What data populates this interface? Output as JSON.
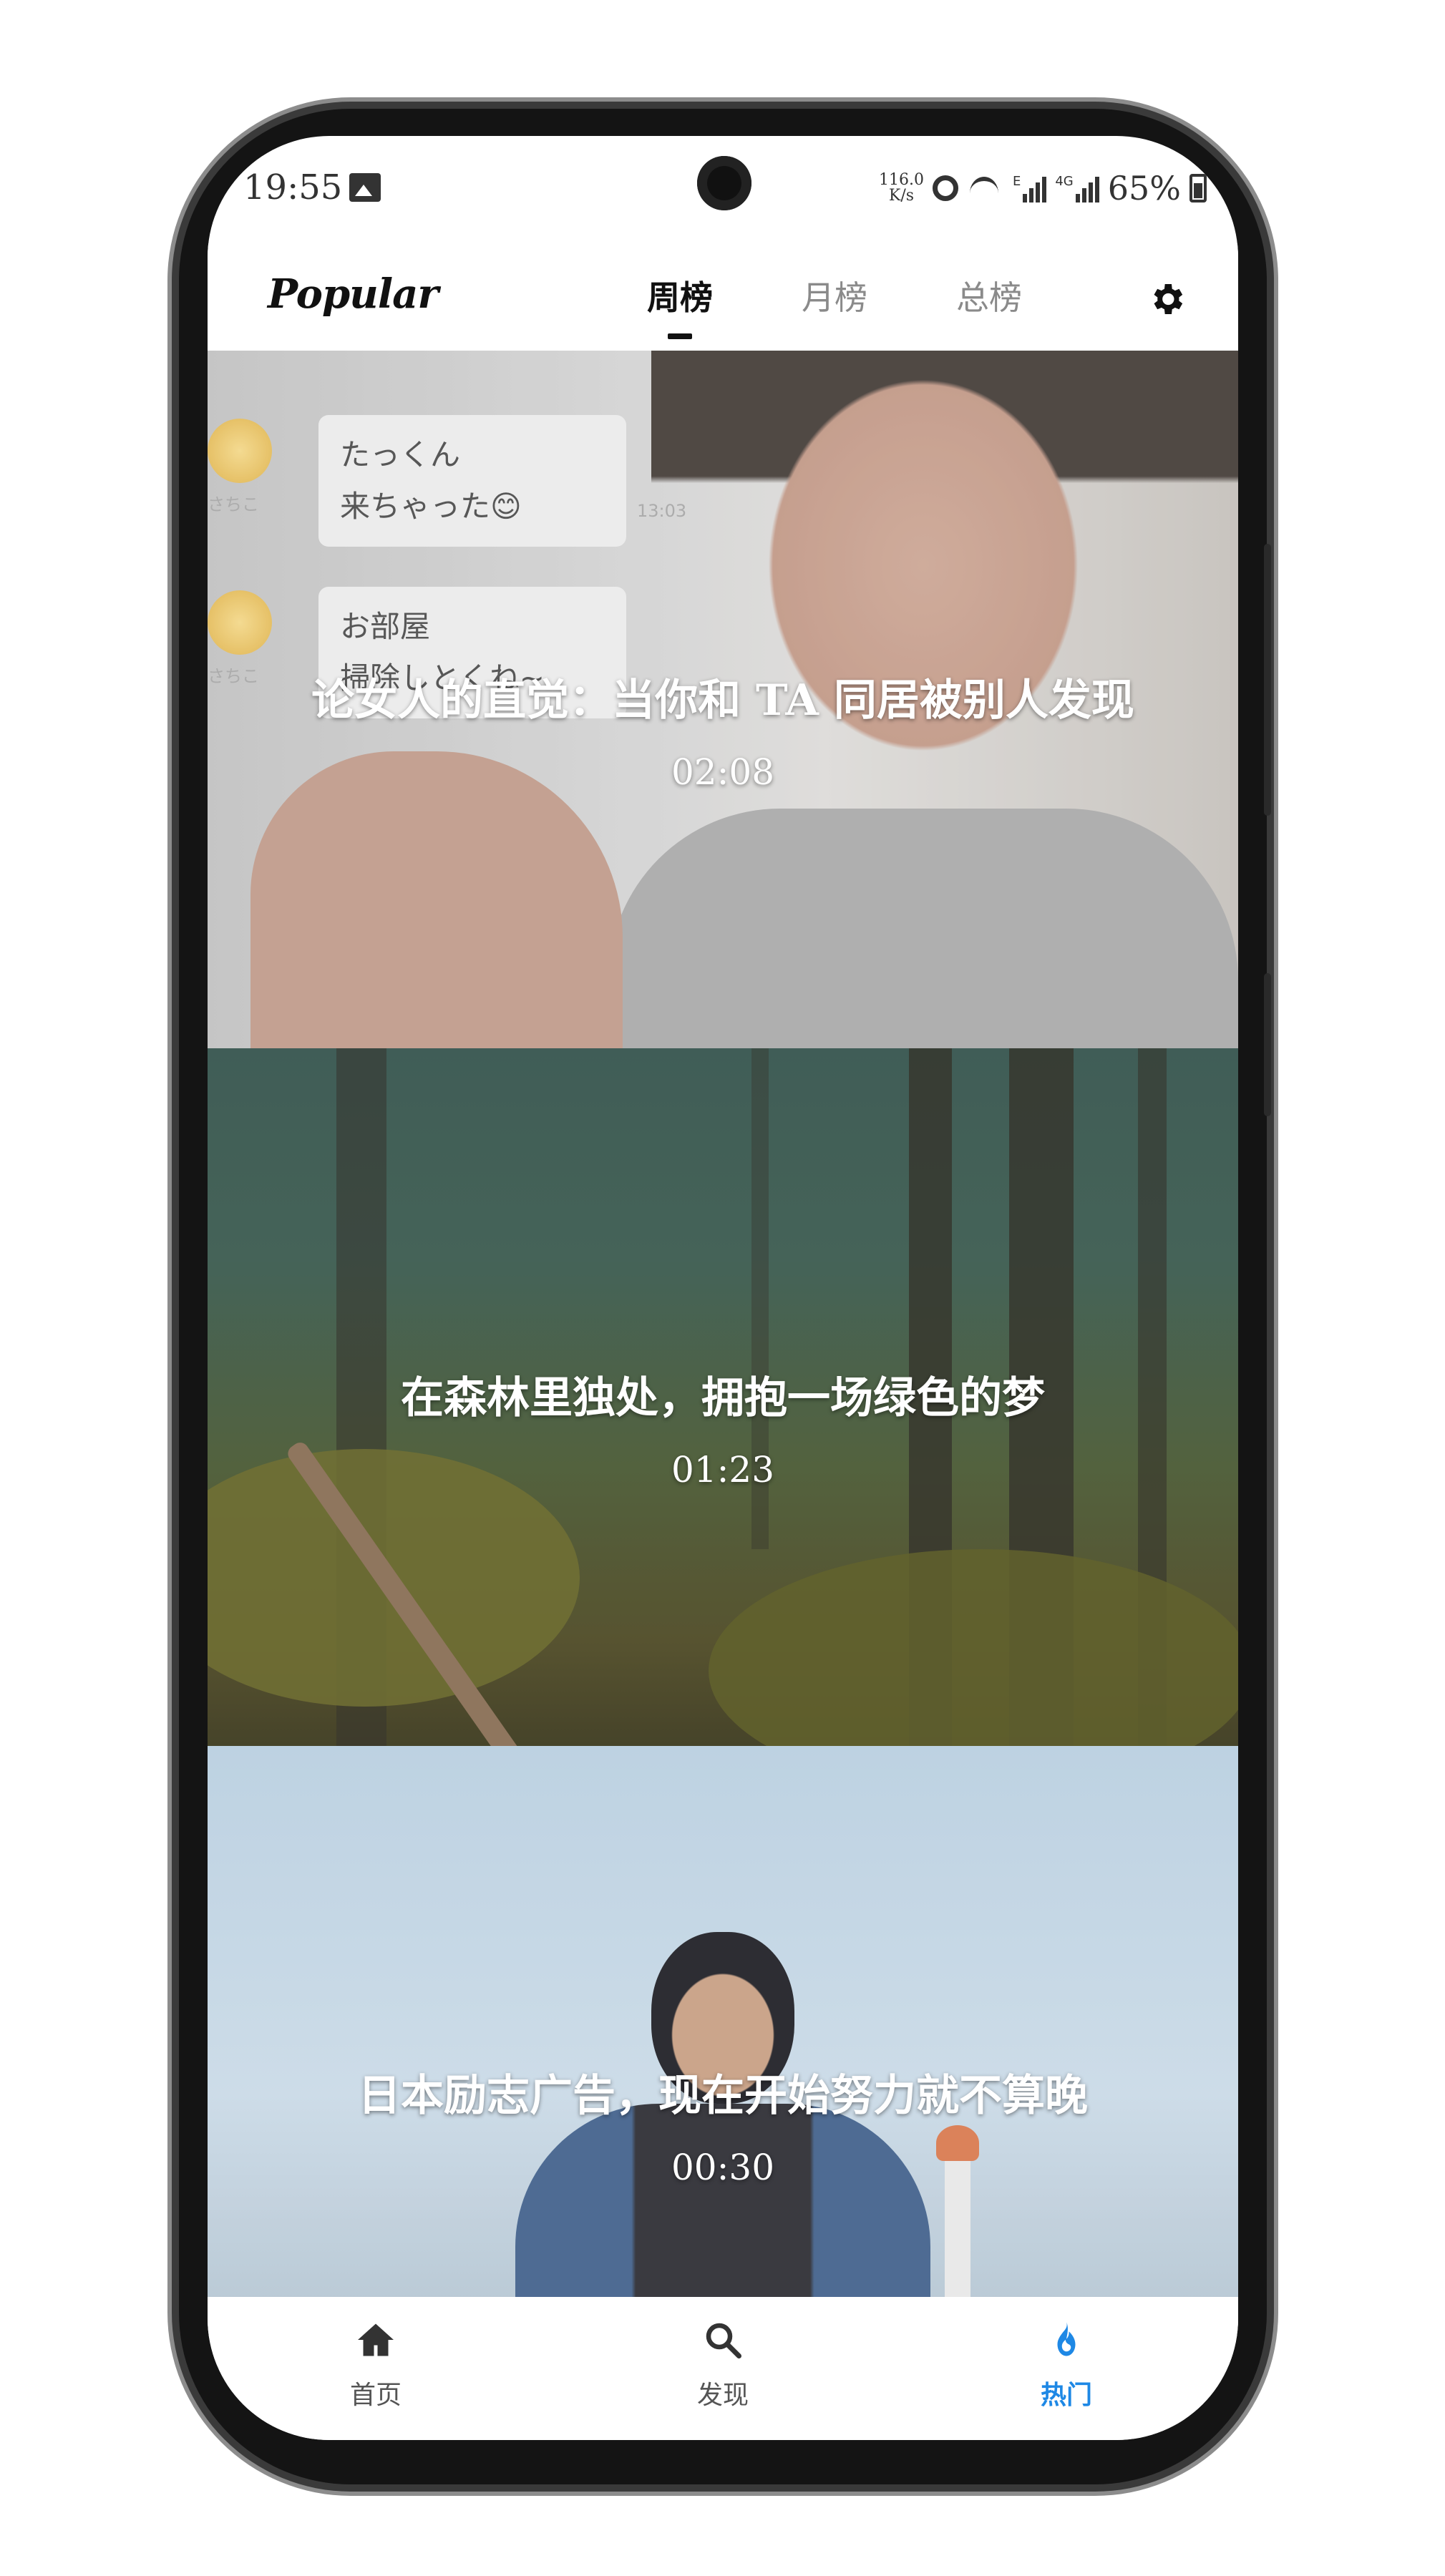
{
  "status_bar": {
    "time": "19:55",
    "net_speed_value": "116.0",
    "net_speed_unit": "K/s",
    "signal_1_tag": "E",
    "signal_2_tag": "4G",
    "battery": "65%"
  },
  "header": {
    "app_title": "Popular",
    "tabs": [
      {
        "label": "周榜",
        "active": true
      },
      {
        "label": "月榜",
        "active": false
      },
      {
        "label": "总榜",
        "active": false
      }
    ]
  },
  "videos": [
    {
      "title": "论女人的直觉：当你和 TA 同居被别人发现",
      "duration": "02:08",
      "chat": {
        "name": "さちこ",
        "bubble1_line1": "たっくん",
        "bubble1_line2": "来ちゃった😊",
        "time": "13:03",
        "bubble2_line1": "お部屋",
        "bubble2_line2": "掃除しとくね~"
      }
    },
    {
      "title": "在森林里独处，拥抱一场绿色的梦",
      "duration": "01:23"
    },
    {
      "title": "日本励志广告，现在开始努力就不算晚",
      "duration": "00:30"
    }
  ],
  "bottom_nav": [
    {
      "label": "首页",
      "icon": "home-icon",
      "active": false
    },
    {
      "label": "发现",
      "icon": "search-icon",
      "active": false
    },
    {
      "label": "热门",
      "icon": "flame-icon",
      "active": true
    }
  ],
  "colors": {
    "accent": "#1e88e5",
    "tab_active": "#111111",
    "tab_inactive": "#8a8a8a"
  }
}
